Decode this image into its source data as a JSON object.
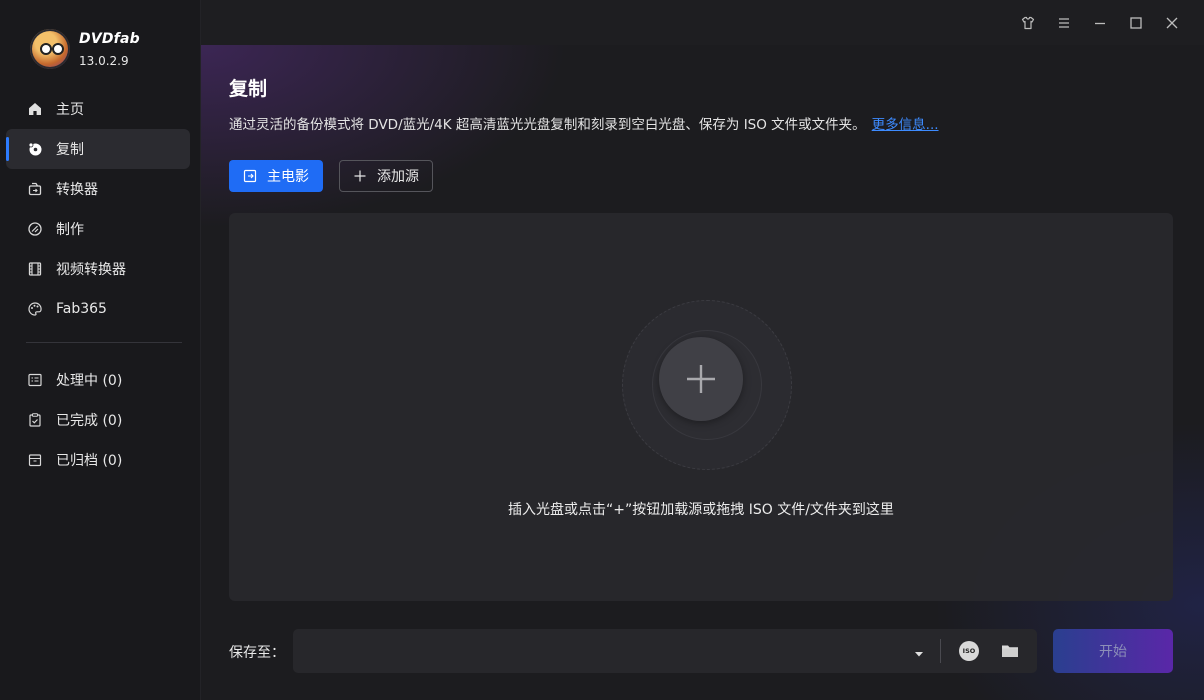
{
  "app": {
    "brand_name": "DVDfab",
    "version": "13.0.2.9"
  },
  "sidebar": {
    "items": [
      {
        "label": "主页",
        "icon": "home-icon"
      },
      {
        "label": "复制",
        "icon": "disc-copy-icon",
        "active": true
      },
      {
        "label": "转换器",
        "icon": "converter-icon"
      },
      {
        "label": "制作",
        "icon": "creator-icon"
      },
      {
        "label": "视频转换器",
        "icon": "film-icon"
      },
      {
        "label": "Fab365",
        "icon": "palette-icon"
      }
    ],
    "queue": [
      {
        "label": "处理中 (0)",
        "icon": "processing-list-icon"
      },
      {
        "label": "已完成 (0)",
        "icon": "completed-clipboard-icon"
      },
      {
        "label": "已归档 (0)",
        "icon": "archive-box-icon"
      }
    ]
  },
  "window_controls": [
    "skin-icon",
    "menu-icon",
    "minimize-icon",
    "maximize-icon",
    "close-icon"
  ],
  "main": {
    "title": "复制",
    "description": "通过灵活的备份模式将 DVD/蓝光/4K 超高清蓝光光盘复制和刻录到空白光盘、保存为 ISO 文件或文件夹。",
    "more_info_link": "更多信息...",
    "mode_button": "主电影",
    "add_source_button": "添加源",
    "drop_hint": "插入光盘或点击“+”按钮加载源或拖拽 ISO 文件/文件夹到这里",
    "save_to_label": "保存至：",
    "save_path_value": "",
    "iso_badge": "ISO",
    "start_button": "开始"
  },
  "colors": {
    "accent": "#1f6cf5",
    "link": "#3d8bff",
    "sidebar_bg": "#19191c",
    "main_bg": "#1c1c1f"
  }
}
